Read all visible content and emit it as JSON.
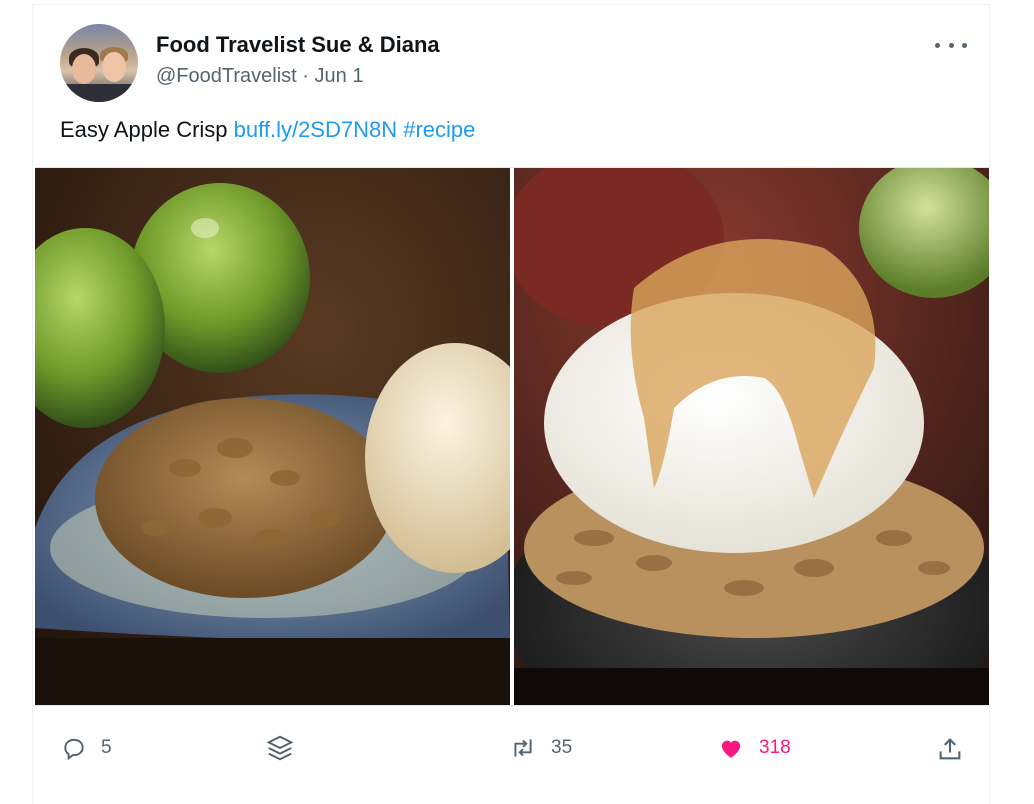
{
  "tweet": {
    "author_name": "Food Travelist Sue & Diana",
    "handle": "@FoodTravelist",
    "separator": "·",
    "date": "Jun 1",
    "text": "Easy Apple Crisp",
    "link": "buff.ly/2SD7N8N",
    "hashtag": "#recipe"
  },
  "media": {
    "photos": [
      {
        "name": "apple-crisp-with-green-apples"
      },
      {
        "name": "apple-crisp-with-caramel-ice-cream"
      }
    ]
  },
  "actions": {
    "replies": "5",
    "retweets": "35",
    "likes": "318"
  },
  "icons": {
    "reply": "reply-icon",
    "stack": "stack-icon",
    "retweet": "retweet-icon",
    "like": "heart-icon",
    "share": "share-icon",
    "more": "more-icon"
  },
  "colors": {
    "link": "#1d9bf0",
    "like": "#f91880",
    "muted": "#536471",
    "text": "#0f1419"
  }
}
